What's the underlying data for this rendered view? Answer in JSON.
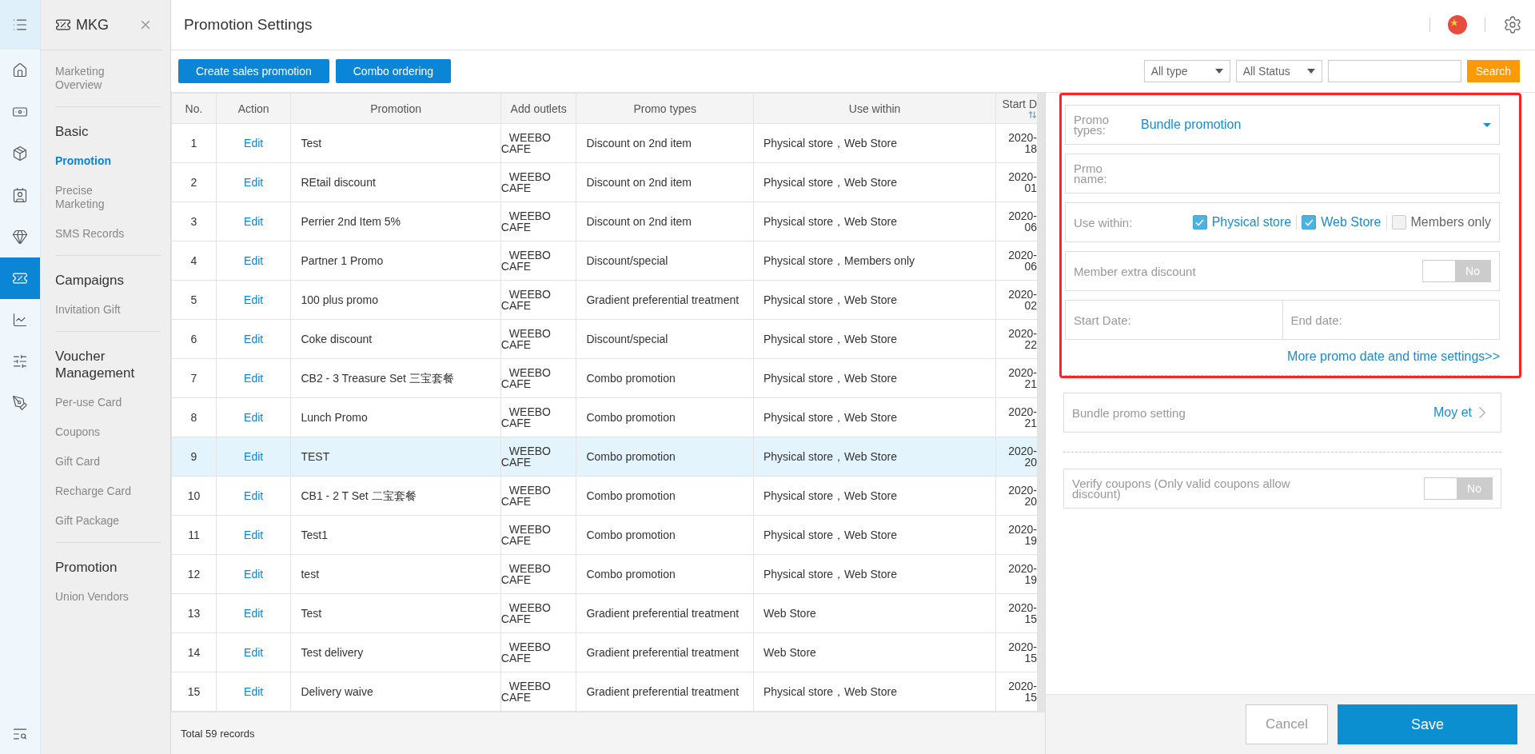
{
  "rail": [
    {
      "selected": false
    },
    {
      "selected": false
    },
    {
      "selected": false
    },
    {
      "selected": false
    },
    {
      "selected": false
    },
    {
      "selected": false
    },
    {
      "selected": true
    },
    {
      "selected": false
    },
    {
      "selected": false
    },
    {
      "selected": false
    }
  ],
  "sidebar": {
    "title": "MKG",
    "groups": [
      {
        "items": [
          {
            "label": "Marketing Overview",
            "selected": false
          }
        ]
      },
      {
        "heading": "Basic",
        "items": [
          {
            "label": "Promotion",
            "selected": true
          },
          {
            "label": "Precise Marketing",
            "selected": false
          },
          {
            "label": "SMS Records",
            "selected": false
          }
        ]
      },
      {
        "heading": "Campaigns",
        "items": [
          {
            "label": "Invitation Gift",
            "selected": false
          }
        ]
      },
      {
        "heading": "Voucher Management",
        "items": [
          {
            "label": "Per-use Card",
            "selected": false
          },
          {
            "label": "Coupons",
            "selected": false
          },
          {
            "label": "Gift Card",
            "selected": false
          },
          {
            "label": "Recharge Card",
            "selected": false
          },
          {
            "label": "Gift Package",
            "selected": false
          }
        ]
      },
      {
        "heading": "Promotion",
        "items": [
          {
            "label": "Union Vendors",
            "selected": false
          }
        ]
      }
    ]
  },
  "page": {
    "title": "Promotion Settings"
  },
  "actions": [
    "Create sales promotion",
    "Combo ordering"
  ],
  "filters": {
    "type": "All type",
    "status": "All Status",
    "search_button": "Search"
  },
  "table": {
    "columns": [
      "No.",
      "Action",
      "Promotion",
      "Add outlets",
      "Promo types",
      "Use within",
      "Start D"
    ],
    "rows": [
      {
        "no": "1",
        "action": "Edit",
        "promotion": "Test",
        "outlets": "WEEBO CAFE",
        "type": "Discount on 2nd item",
        "use_within": "Physical store，Web Store",
        "start": [
          "2020-",
          "18"
        ],
        "selected": false
      },
      {
        "no": "2",
        "action": "Edit",
        "promotion": "REtail discount",
        "outlets": "WEEBO CAFE",
        "type": "Discount on 2nd item",
        "use_within": "Physical store，Web Store",
        "start": [
          "2020-",
          "01"
        ],
        "selected": false
      },
      {
        "no": "3",
        "action": "Edit",
        "promotion": "Perrier 2nd Item 5%",
        "outlets": "WEEBO CAFE",
        "type": "Discount on 2nd item",
        "use_within": "Physical store，Web Store",
        "start": [
          "2020-",
          "06"
        ],
        "selected": false
      },
      {
        "no": "4",
        "action": "Edit",
        "promotion": "Partner 1 Promo",
        "outlets": "WEEBO CAFE",
        "type": "Discount/special",
        "use_within": "Physical store，Members only",
        "start": [
          "2020-",
          "06"
        ],
        "selected": false
      },
      {
        "no": "5",
        "action": "Edit",
        "promotion": "100 plus promo",
        "outlets": "WEEBO CAFE",
        "type": "Gradient preferential treatment",
        "use_within": "Physical store，Web Store",
        "start": [
          "2020-",
          "02"
        ],
        "selected": false
      },
      {
        "no": "6",
        "action": "Edit",
        "promotion": "Coke discount",
        "outlets": "WEEBO CAFE",
        "type": "Discount/special",
        "use_within": "Physical store，Web Store",
        "start": [
          "2020-",
          "22"
        ],
        "selected": false
      },
      {
        "no": "7",
        "action": "Edit",
        "promotion": "CB2 - 3 Treasure Set 三宝套餐",
        "outlets": "WEEBO CAFE",
        "type": "Combo promotion",
        "use_within": "Physical store，Web Store",
        "start": [
          "2020-",
          "21"
        ],
        "selected": false
      },
      {
        "no": "8",
        "action": "Edit",
        "promotion": "Lunch Promo",
        "outlets": "WEEBO CAFE",
        "type": "Combo promotion",
        "use_within": "Physical store，Web Store",
        "start": [
          "2020-",
          "21"
        ],
        "selected": false
      },
      {
        "no": "9",
        "action": "Edit",
        "promotion": "TEST",
        "outlets": "WEEBO CAFE",
        "type": "Combo promotion",
        "use_within": "Physical store，Web Store",
        "start": [
          "2020-",
          "20"
        ],
        "selected": true
      },
      {
        "no": "10",
        "action": "Edit",
        "promotion": "CB1 - 2 T Set 二宝套餐",
        "outlets": "WEEBO CAFE",
        "type": "Combo promotion",
        "use_within": "Physical store，Web Store",
        "start": [
          "2020-",
          "20"
        ],
        "selected": false
      },
      {
        "no": "11",
        "action": "Edit",
        "promotion": "Test1",
        "outlets": "WEEBO CAFE",
        "type": "Combo promotion",
        "use_within": "Physical store，Web Store",
        "start": [
          "2020-",
          "19"
        ],
        "selected": false
      },
      {
        "no": "12",
        "action": "Edit",
        "promotion": "test",
        "outlets": "WEEBO CAFE",
        "type": "Combo promotion",
        "use_within": "Physical store，Web Store",
        "start": [
          "2020-",
          "19"
        ],
        "selected": false
      },
      {
        "no": "13",
        "action": "Edit",
        "promotion": "Test",
        "outlets": "WEEBO CAFE",
        "type": "Gradient preferential treatment",
        "use_within": "Web Store",
        "start": [
          "2020-",
          "15"
        ],
        "selected": false
      },
      {
        "no": "14",
        "action": "Edit",
        "promotion": "Test delivery",
        "outlets": "WEEBO CAFE",
        "type": "Gradient preferential treatment",
        "use_within": "Web Store",
        "start": [
          "2020-",
          "15"
        ],
        "selected": false
      },
      {
        "no": "15",
        "action": "Edit",
        "promotion": "Delivery waive",
        "outlets": "WEEBO CAFE",
        "type": "Gradient preferential treatment",
        "use_within": "Physical store，Web Store",
        "start": [
          "2020-",
          "15"
        ],
        "selected": false
      }
    ],
    "total": "Total 59 records"
  },
  "drawer": {
    "highlighted": true,
    "promo_type": {
      "label": "Promo types:",
      "value": "Bundle promotion"
    },
    "promo_name": {
      "label": "Prmo name:"
    },
    "use_within": {
      "label": "Use within:",
      "options": [
        {
          "label": "Physical store",
          "checked": true
        },
        {
          "label": "Web Store",
          "checked": true
        },
        {
          "label": "Members only",
          "checked": false
        }
      ]
    },
    "member_discount": {
      "label": "Member extra discount",
      "on": false,
      "state": "No"
    },
    "start_date": {
      "label": "Start Date:"
    },
    "end_date": {
      "label": "End date:"
    },
    "more_link": "More promo date and time settings>>",
    "bundle": {
      "label": "Bundle promo setting",
      "value": "Moy et"
    },
    "verify": {
      "label": "Verify coupons (Only valid coupons allow discount)",
      "on": false,
      "state": "No"
    },
    "cancel": "Cancel",
    "save": "Save"
  }
}
